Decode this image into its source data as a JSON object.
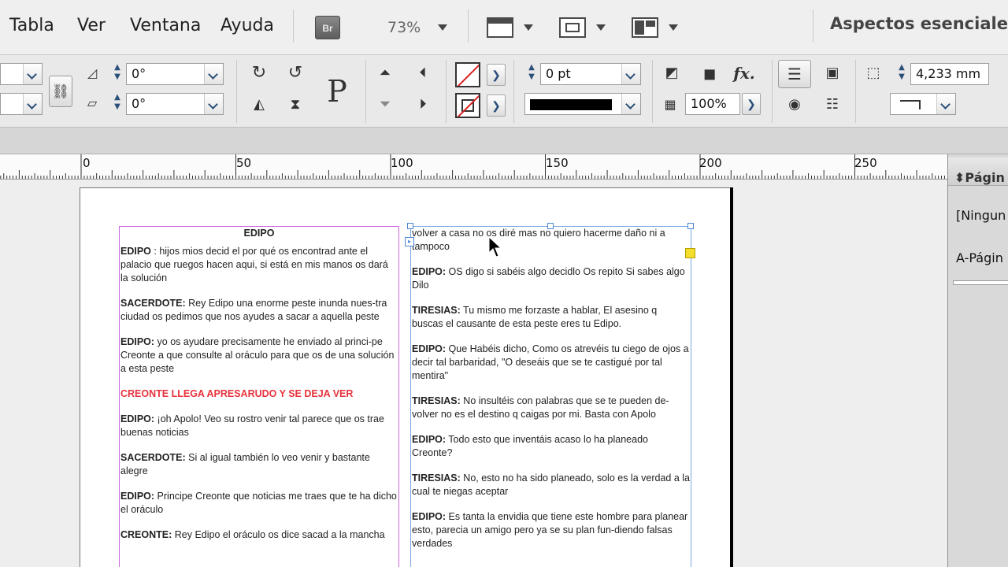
{
  "menu": {
    "items": [
      "Tabla",
      "Ver",
      "Ventana",
      "Ayuda"
    ],
    "bridge": "Br",
    "zoom": "73%",
    "workspace": "Aspectos esenciales"
  },
  "control": {
    "rotate_angle": "0°",
    "shear_angle": "0°",
    "stroke_weight": "0 pt",
    "opacity": "100%",
    "measure": "4,233 mm",
    "text_icon": "P",
    "fx_icon": "fx."
  },
  "ruler": {
    "labels": [
      "0",
      "50",
      "100",
      "150",
      "200",
      "250"
    ]
  },
  "document": {
    "col1": {
      "title": "EDIPO",
      "paragraphs": [
        {
          "speaker": "EDIPO",
          "text": " : hijos mios decid el por qué os encontrad ante el palacio que ruegos hacen aqui, si está en mis manos os dará la solución"
        },
        {
          "speaker": "SACERDOTE:",
          "text": " Rey Edipo una enorme peste inunda nues-tra ciudad os pedimos que nos ayudes a sacar a aquella peste"
        },
        {
          "speaker": "EDIPO:",
          "text": " yo os ayudare precisamente he enviado al princi-pe Creonte a que consulte al oráculo para que os de una solución a esta peste"
        },
        {
          "stage": "CREONTE LLEGA APRESARUDO Y SE DEJA VER"
        },
        {
          "speaker": "EDIPO:",
          "text": " ¡oh Apolo! Veo su rostro venir tal parece que os trae buenas noticias"
        },
        {
          "speaker": "SACERDOTE:",
          "text": " Si al igual también lo veo venir y bastante alegre"
        },
        {
          "speaker": "EDIPO:",
          "text": "  Principe Creonte que noticias me traes que te ha dicho el oráculo"
        },
        {
          "speaker": "CREONTE:",
          "text": " Rey Edipo el oráculo os dice sacad a la mancha"
        }
      ]
    },
    "col2": {
      "paragraphs": [
        {
          "text": "volver a casa no os diré mas no quiero hacerme daño ni a tampoco"
        },
        {
          "speaker": "EDIPO:",
          "text": " OS digo si sabéis algo decidlo Os repito Si sabes algo Dilo"
        },
        {
          "speaker": "TIRESIAS:",
          "text": " Tu mismo me forzaste a hablar, El asesino q buscas el causante de esta peste  eres tu Edipo."
        },
        {
          "speaker": "EDIPO:",
          "text": " Que Habéis dicho, Como os atrevéis tu ciego de ojos  a decir tal barbaridad, \"O deseáis que se te castigué por tal mentira\""
        },
        {
          "speaker": "TIRESIAS:",
          "text": " No insultéis con palabras que  se te pueden de-volver no es el destino q caigas por mi. Basta con Apolo"
        },
        {
          "speaker": "EDIPO:",
          "text": " Todo esto que inventáis acaso lo ha planeado Creonte?"
        },
        {
          "speaker": "TIRESIAS:",
          "text": " No, esto no ha sido planeado, solo es la verdad a la cual te niegas aceptar"
        },
        {
          "speaker": "EDIPO:",
          "text": " Es tanta la envidia que tiene este hombre para planear esto,  parecia un amigo pero ya se su plan fun-diendo falsas verdades"
        }
      ]
    }
  },
  "pages_panel": {
    "title": "Págin",
    "items": [
      "[Ningun",
      "A-Págin"
    ]
  }
}
